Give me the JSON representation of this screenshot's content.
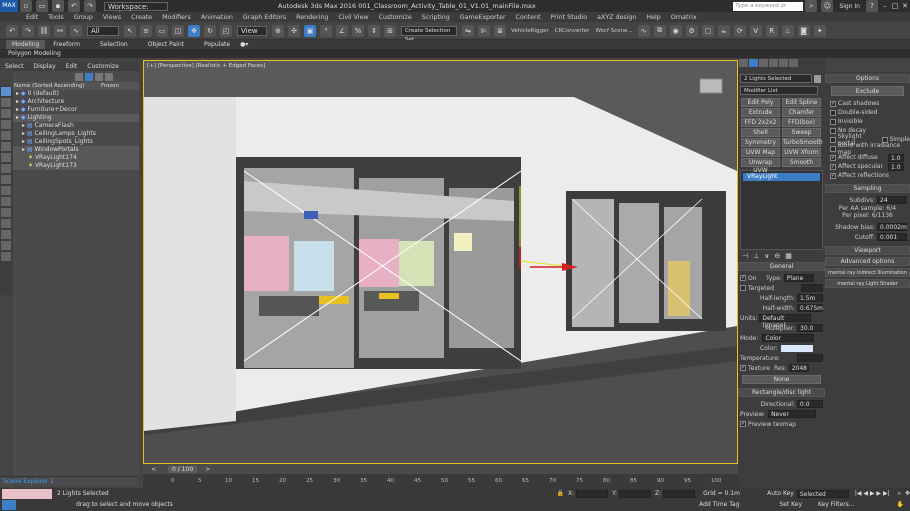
{
  "titlebar": {
    "workspace": "Workspace: Default",
    "title": "Autodesk 3ds Max 2016    001_Classroom_Activity_Table_01_V1.01_mainFile.max",
    "search_placeholder": "Type a keyword or phrase",
    "sign_in": "Sign In"
  },
  "menubar": [
    "Edit",
    "Tools",
    "Group",
    "Views",
    "Create",
    "Modifiers",
    "Animation",
    "Graph Editors",
    "Rendering",
    "Civil View",
    "Customize",
    "Scripting",
    "GameExporter",
    "Content",
    "Print Studio",
    "aXYZ design",
    "Help",
    "Ornatrix"
  ],
  "toolbar": {
    "selection_filter": "All",
    "view_dropdown": "View",
    "create_selection_set": "Create Selection Set",
    "plugins": [
      "VehicleRigger",
      "CRConverter",
      "Wocf Scene..."
    ]
  },
  "ribbon": {
    "tabs": [
      "Modeling",
      "Freeform",
      "Selection",
      "Object Paint",
      "Populate"
    ],
    "active": "Modeling",
    "sub": "Polygon Modeling"
  },
  "scene_explorer": {
    "menu": [
      "Select",
      "Display",
      "Edit",
      "Customize"
    ],
    "col_name": "Name (Sorted Ascending)",
    "col_frozen": "Frozen",
    "items": [
      {
        "label": "0 (default)",
        "indent": 0,
        "state": "normal"
      },
      {
        "label": "Architecture",
        "indent": 0,
        "state": "normal"
      },
      {
        "label": "Furniture+Decor",
        "indent": 0,
        "state": "normal"
      },
      {
        "label": "Lighting",
        "indent": 0,
        "state": "hl"
      },
      {
        "label": "CameraFlash",
        "indent": 1,
        "state": "normal"
      },
      {
        "label": "CeilingLamps_Lights",
        "indent": 1,
        "state": "normal"
      },
      {
        "label": "CeilingSpots_Lights",
        "indent": 1,
        "state": "normal"
      },
      {
        "label": "WindowPortals",
        "indent": 1,
        "state": "sel"
      },
      {
        "label": "VRayLight174",
        "indent": 2,
        "state": "sel"
      },
      {
        "label": "VRayLight173",
        "indent": 2,
        "state": "sel"
      }
    ],
    "footer": "Scene Explorer 1"
  },
  "viewport": {
    "label": "[+] [Perspective] [Realistic + Edged Faces]"
  },
  "command_panel": {
    "selection": "2 Lights Selected",
    "modifier_list": "Modifier List",
    "mod_buttons": [
      [
        "Edit Poly",
        "Edit Spline"
      ],
      [
        "Extrude",
        "Chamfer"
      ],
      [
        "FFD 2x2x2",
        "FFD(box)"
      ],
      [
        "Shell",
        "Sweep"
      ],
      [
        "Symmetry",
        "TurboSmooth"
      ],
      [
        "UVW Map",
        "UVW Xform"
      ],
      [
        "Unwrap UVW",
        "Smooth"
      ]
    ],
    "stack_item": "VRayLight",
    "general_title": "General",
    "on_label": "On",
    "type_label": "Type:",
    "type_value": "Plane",
    "targeted": "Targeted",
    "half_length_label": "Half-length:",
    "half_length": "1.5m",
    "half_width_label": "Half-width:",
    "half_width": "0.675m",
    "units_label": "Units:",
    "units_value": "Default (image)",
    "multiplier_label": "Multiplier:",
    "multiplier": "30.0",
    "mode_label": "Mode:",
    "mode_value": "Color",
    "color_label": "Color:",
    "temperature_label": "Temperature:",
    "texture_label": "Texture",
    "res_label": "Res:",
    "res_value": "2048",
    "none_btn": "None",
    "rect_title": "Rectangle/disc light",
    "directional_label": "Directional:",
    "directional_value": "0.0",
    "preview_label": "Preview:",
    "preview_value": "Never",
    "preview_texmap": "Preview texmap"
  },
  "right_panel": {
    "options_title": "Options",
    "exclude": "Exclude",
    "options": [
      {
        "label": "Cast shadows",
        "checked": true
      },
      {
        "label": "Double-sided",
        "checked": false
      },
      {
        "label": "Invisible",
        "checked": false
      },
      {
        "label": "No decay",
        "checked": false
      },
      {
        "label": "Skylight portal",
        "checked": false
      },
      {
        "label": "Store with irradiance map",
        "checked": false
      },
      {
        "label": "Affect diffuse",
        "checked": true
      },
      {
        "label": "Affect specular",
        "checked": true
      },
      {
        "label": "Affect reflections",
        "checked": true
      }
    ],
    "simple": "Simple",
    "diffuse_val": "1.0",
    "specular_val": "1.0",
    "sampling_title": "Sampling",
    "subdivs_label": "Subdivs:",
    "subdivs": "24",
    "per_aa": "Per AA sample: 6/4",
    "per_pixel": "Per pixel: 6/1136",
    "shadow_bias_label": "Shadow bias:",
    "shadow_bias": "0.0002m",
    "cutoff_label": "Cutoff:",
    "cutoff": "0.001",
    "rollouts": [
      "Viewport",
      "Advanced options",
      "mental ray Indirect Illumination",
      "mental ray Light Shader"
    ]
  },
  "timeline": {
    "frame": "0 / 100",
    "ticks": [
      "0",
      "5",
      "10",
      "15",
      "20",
      "25",
      "30",
      "35",
      "40",
      "45",
      "50",
      "55",
      "60",
      "65",
      "70",
      "75",
      "80",
      "85",
      "90",
      "95",
      "100"
    ]
  },
  "statusbar": {
    "selected": "2 Lights Selected",
    "prompt": "drag to select and move objects",
    "x_label": "X:",
    "y_label": "Y:",
    "z_label": "Z:",
    "grid": "Grid = 0.1m",
    "add_time_tag": "Add Time Tag",
    "auto_key": "Auto Key",
    "selected_dropdown": "Selected",
    "set_key": "Set Key",
    "key_filters": "Key Filters..."
  }
}
